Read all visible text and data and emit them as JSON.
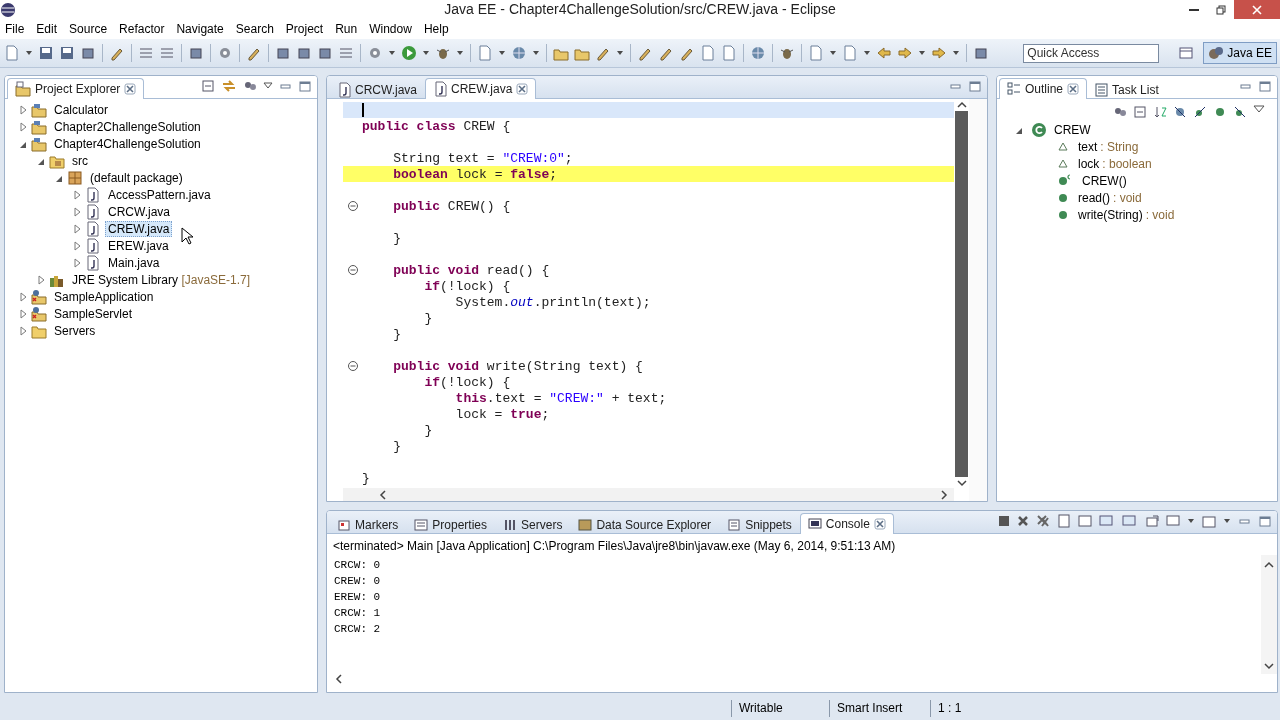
{
  "window": {
    "title": "Java EE - Chapter4ChallengeSolution/src/CREW.java - Eclipse"
  },
  "menu": [
    "File",
    "Edit",
    "Source",
    "Refactor",
    "Navigate",
    "Search",
    "Project",
    "Run",
    "Window",
    "Help"
  ],
  "toolbar": {
    "quick_access": {
      "placeholder": "Quick Access"
    },
    "perspective": {
      "label": "Java EE",
      "selected": true
    }
  },
  "project_explorer": {
    "title": "Project Explorer",
    "items": [
      {
        "label": "Calculator",
        "kind": "project",
        "expanded": false,
        "selected": false
      },
      {
        "label": "Chapter2ChallengeSolution",
        "kind": "project",
        "expanded": false,
        "selected": false
      },
      {
        "label": "Chapter4ChallengeSolution",
        "kind": "project",
        "expanded": true,
        "selected": false,
        "children": [
          {
            "label": "src",
            "kind": "source_folder",
            "expanded": true,
            "selected": false,
            "children": [
              {
                "label": "(default package)",
                "kind": "package",
                "expanded": true,
                "selected": false,
                "children": [
                  {
                    "label": "AccessPattern.java",
                    "kind": "java",
                    "expanded": false,
                    "selected": false
                  },
                  {
                    "label": "CRCW.java",
                    "kind": "java",
                    "expanded": false,
                    "selected": false
                  },
                  {
                    "label": "CREW.java",
                    "kind": "java",
                    "expanded": false,
                    "selected": true
                  },
                  {
                    "label": "EREW.java",
                    "kind": "java",
                    "expanded": false,
                    "selected": false
                  },
                  {
                    "label": "Main.java",
                    "kind": "java",
                    "expanded": false,
                    "selected": false
                  }
                ]
              }
            ]
          },
          {
            "label": "JRE System Library",
            "detail": "[JavaSE-1.7]",
            "kind": "library",
            "expanded": false,
            "selected": false
          }
        ]
      },
      {
        "label": "SampleApplication",
        "kind": "web_project",
        "expanded": false,
        "selected": false
      },
      {
        "label": "SampleServlet",
        "kind": "web_project",
        "expanded": false,
        "selected": false
      },
      {
        "label": "Servers",
        "kind": "folder",
        "expanded": false,
        "selected": false
      }
    ]
  },
  "editor": {
    "tabs": [
      {
        "label": "CRCW.java",
        "selected": false
      },
      {
        "label": "CREW.java",
        "selected": true
      }
    ],
    "lines": [
      {
        "kind": "blank",
        "fold": false,
        "highlighted": false,
        "current": true
      },
      {
        "kind": "code",
        "fold": false,
        "highlighted": false,
        "current": false,
        "tokens": [
          {
            "text": "public class ",
            "kind": "keyword"
          },
          {
            "text": "CREW {",
            "kind": "plain"
          }
        ]
      },
      {
        "kind": "blank",
        "fold": false,
        "highlighted": false,
        "current": false
      },
      {
        "kind": "code",
        "fold": false,
        "highlighted": false,
        "current": false,
        "tokens": [
          {
            "text": "    String text = ",
            "kind": "plain"
          },
          {
            "text": "\"CREW:0\"",
            "kind": "string"
          },
          {
            "text": ";",
            "kind": "plain"
          }
        ]
      },
      {
        "kind": "code",
        "fold": false,
        "highlighted": true,
        "current": false,
        "tokens": [
          {
            "text": "    boolean ",
            "kind": "keyword"
          },
          {
            "text": "lock = ",
            "kind": "plain"
          },
          {
            "text": "false",
            "kind": "keyword"
          },
          {
            "text": ";",
            "kind": "plain"
          }
        ]
      },
      {
        "kind": "blank",
        "fold": false,
        "highlighted": false,
        "current": false
      },
      {
        "kind": "code",
        "fold": true,
        "highlighted": false,
        "current": false,
        "tokens": [
          {
            "text": "    public ",
            "kind": "keyword"
          },
          {
            "text": "CREW() {",
            "kind": "plain"
          }
        ]
      },
      {
        "kind": "blank",
        "fold": false,
        "highlighted": false,
        "current": false
      },
      {
        "kind": "code",
        "fold": false,
        "highlighted": false,
        "current": false,
        "tokens": [
          {
            "text": "    }",
            "kind": "plain"
          }
        ]
      },
      {
        "kind": "blank",
        "fold": false,
        "highlighted": false,
        "current": false
      },
      {
        "kind": "code",
        "fold": true,
        "highlighted": false,
        "current": false,
        "tokens": [
          {
            "text": "    public void ",
            "kind": "keyword"
          },
          {
            "text": "read() {",
            "kind": "plain"
          }
        ]
      },
      {
        "kind": "code",
        "fold": false,
        "highlighted": false,
        "current": false,
        "tokens": [
          {
            "text": "        if",
            "kind": "keyword"
          },
          {
            "text": "(!lock) {",
            "kind": "plain"
          }
        ]
      },
      {
        "kind": "code",
        "fold": false,
        "highlighted": false,
        "current": false,
        "tokens": [
          {
            "text": "            System.",
            "kind": "plain"
          },
          {
            "text": "out",
            "kind": "static_field"
          },
          {
            "text": ".println(text);",
            "kind": "plain"
          }
        ]
      },
      {
        "kind": "code",
        "fold": false,
        "highlighted": false,
        "current": false,
        "tokens": [
          {
            "text": "        }",
            "kind": "plain"
          }
        ]
      },
      {
        "kind": "code",
        "fold": false,
        "highlighted": false,
        "current": false,
        "tokens": [
          {
            "text": "    }",
            "kind": "plain"
          }
        ]
      },
      {
        "kind": "blank",
        "fold": false,
        "highlighted": false,
        "current": false
      },
      {
        "kind": "code",
        "fold": true,
        "highlighted": false,
        "current": false,
        "tokens": [
          {
            "text": "    public void ",
            "kind": "keyword"
          },
          {
            "text": "write(String text) {",
            "kind": "plain"
          }
        ]
      },
      {
        "kind": "code",
        "fold": false,
        "highlighted": false,
        "current": false,
        "tokens": [
          {
            "text": "        if",
            "kind": "keyword"
          },
          {
            "text": "(!lock) {",
            "kind": "plain"
          }
        ]
      },
      {
        "kind": "code",
        "fold": false,
        "highlighted": false,
        "current": false,
        "tokens": [
          {
            "text": "            this",
            "kind": "keyword"
          },
          {
            "text": ".text = ",
            "kind": "plain"
          },
          {
            "text": "\"CREW:\"",
            "kind": "string"
          },
          {
            "text": " + text;",
            "kind": "plain"
          }
        ]
      },
      {
        "kind": "code",
        "fold": false,
        "highlighted": false,
        "current": false,
        "tokens": [
          {
            "text": "            lock = ",
            "kind": "plain"
          },
          {
            "text": "true",
            "kind": "keyword"
          },
          {
            "text": ";",
            "kind": "plain"
          }
        ]
      },
      {
        "kind": "code",
        "fold": false,
        "highlighted": false,
        "current": false,
        "tokens": [
          {
            "text": "        }",
            "kind": "plain"
          }
        ]
      },
      {
        "kind": "code",
        "fold": false,
        "highlighted": false,
        "current": false,
        "tokens": [
          {
            "text": "    }",
            "kind": "plain"
          }
        ]
      },
      {
        "kind": "blank",
        "fold": false,
        "highlighted": false,
        "current": false
      },
      {
        "kind": "code",
        "fold": false,
        "highlighted": false,
        "current": false,
        "tokens": [
          {
            "text": "}",
            "kind": "plain"
          }
        ]
      }
    ]
  },
  "outline": {
    "tabs": [
      {
        "label": "Outline",
        "selected": true
      },
      {
        "label": "Task List",
        "selected": false
      }
    ],
    "items": [
      {
        "name": "CREW",
        "kind": "class",
        "expanded": true,
        "selected": false,
        "children": [
          {
            "name": "text",
            "detail": ": String",
            "kind": "field",
            "selected": false
          },
          {
            "name": "lock",
            "detail": ": boolean",
            "kind": "field",
            "selected": false
          },
          {
            "name": "CREW()",
            "kind": "constructor",
            "selected": false
          },
          {
            "name": "read()",
            "detail": ": void",
            "kind": "method",
            "selected": false
          },
          {
            "name": "write(String)",
            "detail": ": void",
            "kind": "method",
            "selected": false
          }
        ]
      }
    ]
  },
  "console": {
    "tabs": [
      {
        "label": "Markers",
        "selected": false
      },
      {
        "label": "Properties",
        "selected": false
      },
      {
        "label": "Servers",
        "selected": false
      },
      {
        "label": "Data Source Explorer",
        "selected": false
      },
      {
        "label": "Snippets",
        "selected": false
      },
      {
        "label": "Console",
        "selected": true
      }
    ],
    "header": "<terminated> Main [Java Application] C:\\Program Files\\Java\\jre8\\bin\\javaw.exe (May 6, 2014, 9:51:13 AM)",
    "output": [
      "CRCW: 0",
      "CREW: 0",
      "EREW: 0",
      "CRCW: 1",
      "CRCW: 2"
    ]
  },
  "status_bar": [
    "Writable",
    "Smart Insert",
    "1 : 1"
  ]
}
